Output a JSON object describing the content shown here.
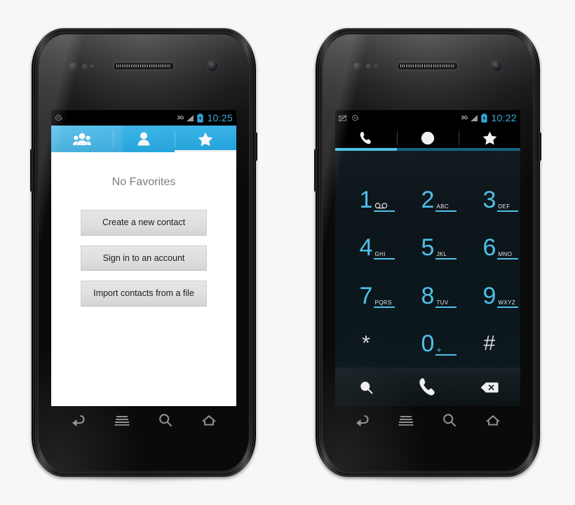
{
  "scene": {
    "title": "Android Contacts and Phone dialer screens"
  },
  "phone_left": {
    "name": "contacts-phone",
    "status_bar": {
      "notification_icons": [
        "disc-icon"
      ],
      "network_label": "3G",
      "signal_icon": "signal-bars-icon",
      "battery_icon": "battery-charging-icon",
      "clock": "10:25"
    },
    "tabs": [
      {
        "id": "groups",
        "icon": "group-contacts-icon",
        "selected": false
      },
      {
        "id": "contacts",
        "icon": "person-icon",
        "selected": false
      },
      {
        "id": "favorites",
        "icon": "star-icon",
        "selected": true
      }
    ],
    "content": {
      "empty_title": "No Favorites",
      "buttons": [
        {
          "id": "create-contact",
          "label": "Create a new contact"
        },
        {
          "id": "sign-in",
          "label": "Sign in to an account"
        },
        {
          "id": "import-file",
          "label": "Import contacts from a file"
        }
      ]
    },
    "nav_keys": [
      {
        "id": "back",
        "icon": "back-arrow-icon"
      },
      {
        "id": "menu",
        "icon": "menu-lines-icon"
      },
      {
        "id": "search",
        "icon": "search-icon"
      },
      {
        "id": "home",
        "icon": "home-icon"
      }
    ]
  },
  "phone_right": {
    "name": "dialer-phone",
    "status_bar": {
      "notification_icons": [
        "email-icon",
        "disc-icon"
      ],
      "network_label": "3G",
      "signal_icon": "signal-bars-icon",
      "battery_icon": "battery-charging-icon",
      "clock": "10:22"
    },
    "tabs": [
      {
        "id": "dialer",
        "icon": "phone-handset-icon",
        "selected": true
      },
      {
        "id": "recents",
        "icon": "clock-icon",
        "selected": false
      },
      {
        "id": "favorites",
        "icon": "star-icon",
        "selected": false
      }
    ],
    "keypad": [
      [
        {
          "digit": "1",
          "letters": "",
          "icon": "voicemail-icon",
          "underline": true,
          "symbol": false
        },
        {
          "digit": "2",
          "letters": "ABC",
          "icon": "",
          "underline": true,
          "symbol": false
        },
        {
          "digit": "3",
          "letters": "DEF",
          "icon": "",
          "underline": true,
          "symbol": false
        }
      ],
      [
        {
          "digit": "4",
          "letters": "GHI",
          "icon": "",
          "underline": true,
          "symbol": false
        },
        {
          "digit": "5",
          "letters": "JKL",
          "icon": "",
          "underline": true,
          "symbol": false
        },
        {
          "digit": "6",
          "letters": "MNO",
          "icon": "",
          "underline": true,
          "symbol": false
        }
      ],
      [
        {
          "digit": "7",
          "letters": "PQRS",
          "icon": "",
          "underline": true,
          "symbol": false
        },
        {
          "digit": "8",
          "letters": "TUV",
          "icon": "",
          "underline": true,
          "symbol": false
        },
        {
          "digit": "9",
          "letters": "WXYZ",
          "icon": "",
          "underline": true,
          "symbol": false
        }
      ],
      [
        {
          "digit": "*",
          "letters": "",
          "icon": "",
          "underline": false,
          "symbol": true
        },
        {
          "digit": "0",
          "letters": "+",
          "icon": "",
          "underline": true,
          "symbol": false
        },
        {
          "digit": "#",
          "letters": "",
          "icon": "",
          "underline": false,
          "symbol": true
        }
      ]
    ],
    "actions": [
      {
        "id": "search",
        "icon": "search-icon"
      },
      {
        "id": "call",
        "icon": "phone-handset-icon"
      },
      {
        "id": "backspace",
        "icon": "backspace-icon"
      }
    ],
    "nav_keys": [
      {
        "id": "back",
        "icon": "back-arrow-icon"
      },
      {
        "id": "menu",
        "icon": "menu-lines-icon"
      },
      {
        "id": "search",
        "icon": "search-icon"
      },
      {
        "id": "home",
        "icon": "home-icon"
      }
    ]
  },
  "colors": {
    "accent_blue": "#4fc0ea",
    "tab_blue": "#29ade6",
    "clock_blue": "#3aaede",
    "button_gray": "#dedede",
    "background": "#f7f7f7"
  }
}
